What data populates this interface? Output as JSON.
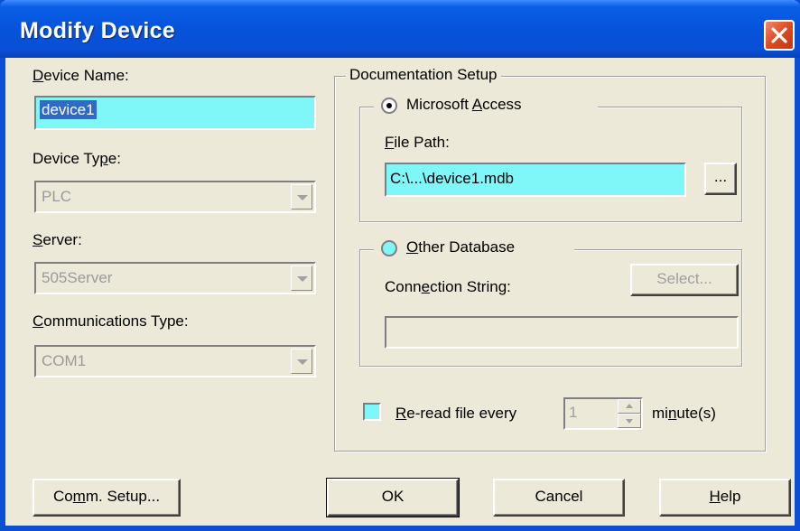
{
  "window": {
    "title": "Modify Device"
  },
  "left": {
    "device_name": {
      "label_underlined": "D",
      "label_rest": "evice Name:",
      "value": "device1"
    },
    "device_type": {
      "label_pre": "Device Ty",
      "label_underlined": "p",
      "label_post": "e:",
      "value": "PLC"
    },
    "server": {
      "label_underlined": "S",
      "label_rest": "erver:",
      "value": "505Server"
    },
    "comm_type": {
      "label_underlined": "C",
      "label_rest": "ommunications Type:",
      "value": "COM1"
    }
  },
  "doc_setup": {
    "legend": "Documentation Setup",
    "access": {
      "option_pre": "Microsoft ",
      "option_underlined": "A",
      "option_post": "ccess",
      "selected": true,
      "file_path_label_underlined": "F",
      "file_path_label_rest": "ile Path:",
      "file_path_value": "C:\\...\\device1.mdb",
      "browse_label": "..."
    },
    "other": {
      "option_underlined": "O",
      "option_rest": "ther Database",
      "selected": false,
      "conn_label_pre": "Conn",
      "conn_label_underlined": "e",
      "conn_label_post": "ction String:",
      "select_label": "Select...",
      "conn_value": ""
    },
    "reread": {
      "label_underlined": "R",
      "label_rest": "e-read file every",
      "value": "1",
      "unit_pre": "mi",
      "unit_underlined": "n",
      "unit_post": "ute(s)"
    }
  },
  "buttons": {
    "comm_setup_pre": "Co",
    "comm_setup_underlined": "m",
    "comm_setup_post": "m. Setup...",
    "ok": "OK",
    "cancel": "Cancel",
    "help_underlined": "H",
    "help_rest": "elp"
  },
  "colors": {
    "title_bar": "#0a4fd6",
    "field_highlight": "#7ff6f8",
    "selection": "#316ac5",
    "dialog_bg": "#ece9d8",
    "close_button": "#dd4a22"
  }
}
